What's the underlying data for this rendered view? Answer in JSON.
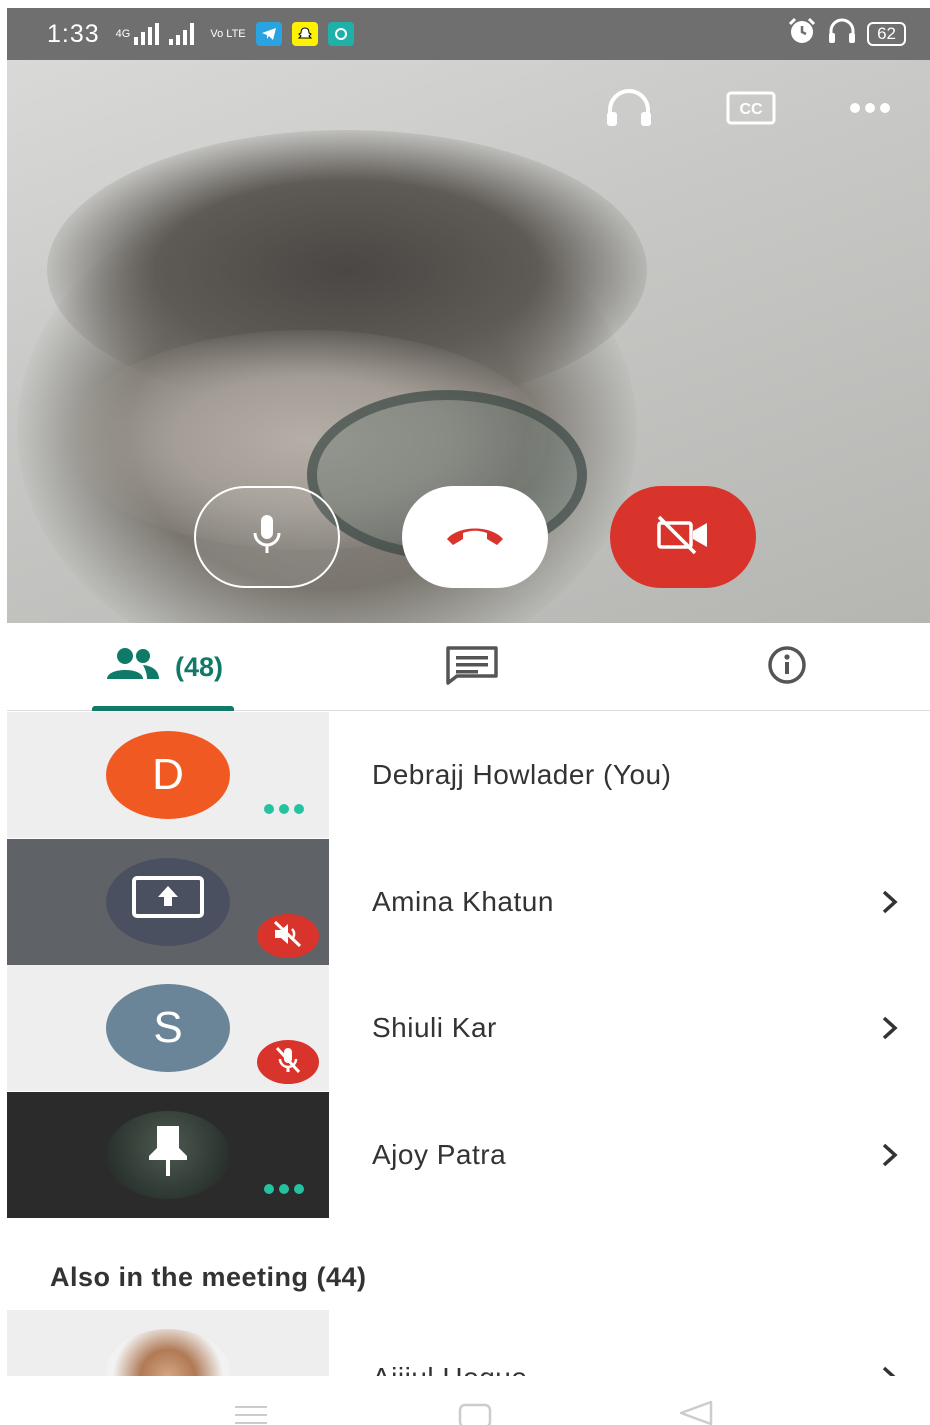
{
  "status_bar": {
    "time": "1:33",
    "network_small": "4G",
    "volte": "Vo LTE",
    "battery": "62"
  },
  "video_controls": {
    "audio_icon": "headphones-icon",
    "captions_icon": "closed-captions-icon",
    "more_icon": "more-horizontal-icon",
    "mic_icon": "microphone-icon",
    "end_call_icon": "end-call-icon",
    "camera_icon": "camera-off-icon"
  },
  "tabs": {
    "people_count": "(48)",
    "people_icon": "people-icon",
    "chat_icon": "chat-icon",
    "info_icon": "info-icon"
  },
  "participants": [
    {
      "initial": "D",
      "name": "Debrajj Howlader (You)",
      "avatar_color": "#f05a22",
      "tile_color": "#eeeeee",
      "status": "more"
    },
    {
      "initial": "",
      "name": "Amina Khatun",
      "avatar_color": "#4b5060",
      "tile_color": "#5f6368",
      "status": "muted"
    },
    {
      "initial": "S",
      "name": "Shiuli Kar",
      "avatar_color": "#6a8597",
      "tile_color": "#eeeeee",
      "status": "muted"
    },
    {
      "initial": "",
      "name": "Ajoy Patra",
      "avatar_color": "#2f3a34",
      "tile_color": "#2b2b2b",
      "status": "more"
    }
  ],
  "also_in_meeting": {
    "title": "Also in the meeting (44)",
    "first_name": "Ajijul Hoque"
  },
  "colors": {
    "accent": "#0f7a67",
    "danger": "#d9342b",
    "dots": "#25c2a0"
  }
}
